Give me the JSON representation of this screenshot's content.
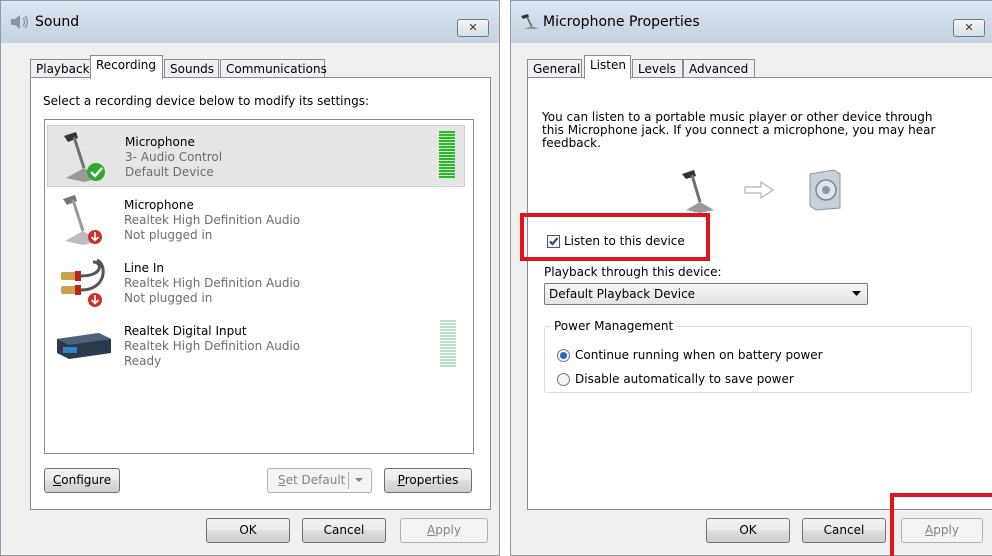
{
  "sound_window": {
    "title": "Sound",
    "close_glyph": "✕",
    "tabs": [
      {
        "label": "Playback"
      },
      {
        "label": "Recording",
        "active": true
      },
      {
        "label": "Sounds"
      },
      {
        "label": "Communications"
      }
    ],
    "instruction": "Select a recording device below to modify its settings:",
    "devices": [
      {
        "name": "Microphone",
        "description": "3- Audio Control",
        "status": "Default Device",
        "icon": "microphone-icon",
        "badge": "default-check-icon",
        "selected": true,
        "meter": "active"
      },
      {
        "name": "Microphone",
        "description": "Realtek High Definition Audio",
        "status": "Not plugged in",
        "icon": "microphone-icon",
        "badge": "unplugged-arrow-icon",
        "selected": false
      },
      {
        "name": "Line In",
        "description": "Realtek High Definition Audio",
        "status": "Not plugged in",
        "icon": "line-in-cable-icon",
        "badge": "unplugged-arrow-icon",
        "selected": false
      },
      {
        "name": "Realtek Digital Input",
        "description": "Realtek High Definition Audio",
        "status": "Ready",
        "icon": "digital-input-device-icon",
        "selected": false,
        "meter": "idle"
      }
    ],
    "buttons": {
      "configure_prefix": "",
      "configure_hotkey": "C",
      "configure_rest": "onfigure",
      "set_default_hotkey": "S",
      "set_default_rest": "et Default",
      "properties_hotkey": "P",
      "properties_rest": "roperties",
      "ok": "OK",
      "cancel": "Cancel",
      "apply_hotkey": "A",
      "apply_rest": "pply"
    },
    "meter_color_active": "#1fbf1f",
    "meter_color_idle": "#b8e0c8"
  },
  "mic_window": {
    "title": "Microphone Properties",
    "close_glyph": "✕",
    "tabs": [
      {
        "label": "General"
      },
      {
        "label": "Listen",
        "active": true
      },
      {
        "label": "Levels"
      },
      {
        "label": "Advanced"
      }
    ],
    "description_lines": [
      "You can listen to a portable music player or other device through",
      "this Microphone jack.  If you connect a microphone, you may hear",
      "feedback."
    ],
    "diagram_icons": [
      "microphone-icon",
      "arrow-right-icon",
      "speaker-icon"
    ],
    "listen_checkbox": {
      "label": "Listen to this device",
      "checked": true
    },
    "playback_label": "Playback through this device:",
    "playback_selected": "Default Playback Device",
    "power_group_label": "Power Management",
    "power_options": [
      {
        "label": "Continue running when on battery power",
        "selected": true
      },
      {
        "label": "Disable automatically to save power",
        "selected": false
      }
    ],
    "buttons": {
      "ok": "OK",
      "cancel": "Cancel",
      "apply_hotkey": "A",
      "apply_rest": "pply"
    }
  },
  "highlight_color": "#e0141e"
}
